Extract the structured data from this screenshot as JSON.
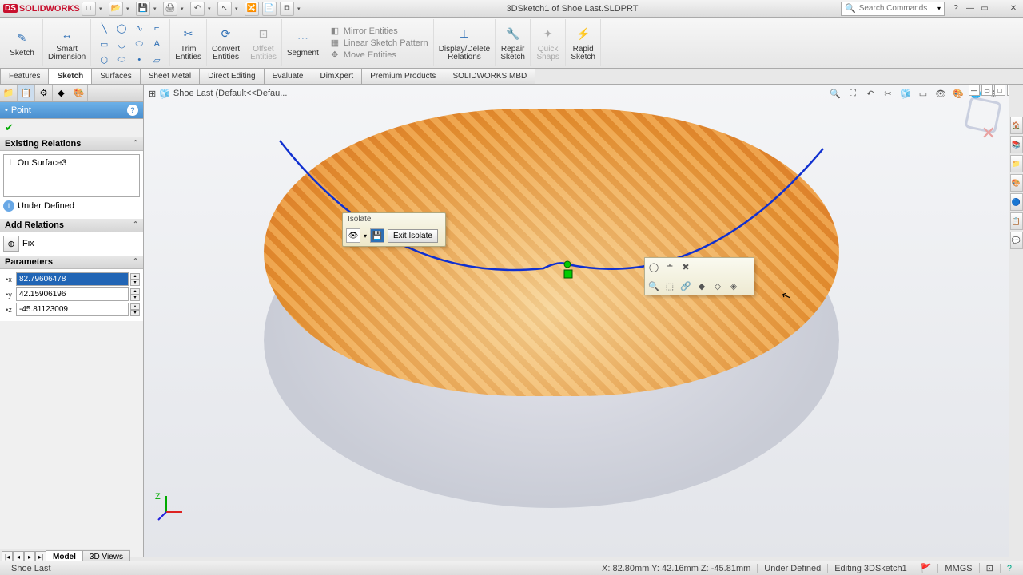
{
  "app": {
    "name": "SOLIDWORKS",
    "title": "3DSketch1 of Shoe Last.SLDPRT"
  },
  "search": {
    "placeholder": "Search Commands"
  },
  "qat": [
    "□",
    "▸",
    "▾",
    "💾",
    "▾",
    "🖨",
    "▾",
    "↶",
    "▾",
    "⤴",
    "▾",
    "⚙",
    "⧉",
    "▾"
  ],
  "ribbon": {
    "sketch": "Sketch",
    "smartDim": "Smart\nDimension",
    "trim": "Trim\nEntities",
    "convert": "Convert\nEntities",
    "offset": "Offset\nEntities",
    "segment": "Segment",
    "mirror": "Mirror Entities",
    "pattern": "Linear Sketch Pattern",
    "move": "Move Entities",
    "dispDel": "Display/Delete\nRelations",
    "repair": "Repair\nSketch",
    "quick": "Quick\nSnaps",
    "rapid": "Rapid\nSketch"
  },
  "tabs": [
    "Features",
    "Sketch",
    "Surfaces",
    "Sheet Metal",
    "Direct Editing",
    "Evaluate",
    "DimXpert",
    "Premium Products",
    "SOLIDWORKS MBD"
  ],
  "activeTab": 1,
  "breadcrumb": "Shoe Last  (Default<<Defau...",
  "isolate": {
    "title": "Isolate",
    "exit": "Exit Isolate"
  },
  "pm": {
    "title": "Point",
    "existingRel": "Existing Relations",
    "relation": "On Surface3",
    "status": "Under Defined",
    "addRel": "Add Relations",
    "fix": "Fix",
    "params": "Parameters",
    "x": "82.79606478",
    "y": "42.15906196",
    "z": "-45.81123009"
  },
  "btmTabs": [
    "Model",
    "3D Views"
  ],
  "statusBar": {
    "left": "Shoe Last",
    "coords": "X: 82.80mm  Y: 42.16mm  Z: -45.81mm",
    "def": "Under Defined",
    "edit": "Editing 3DSketch1",
    "units": "MMGS"
  }
}
